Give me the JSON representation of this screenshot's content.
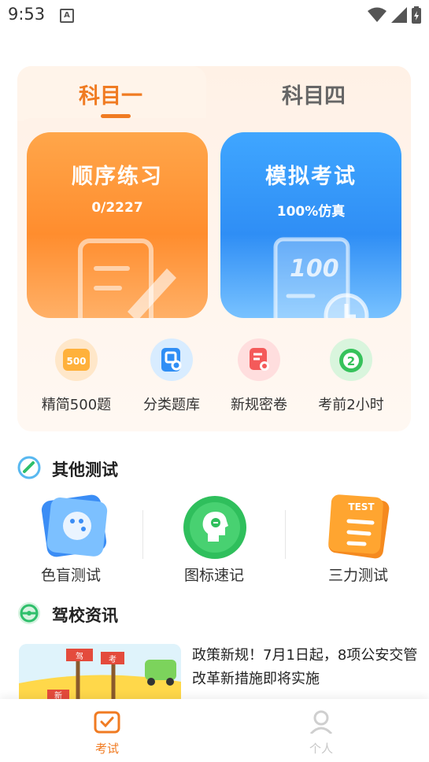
{
  "status_bar": {
    "time": "9:53",
    "notification": "A"
  },
  "subject_tabs": [
    {
      "label": "科目一",
      "active": true
    },
    {
      "label": "科目四",
      "active": false
    }
  ],
  "practice_cards": {
    "sequential": {
      "title": "顺序练习",
      "subtitle": "0/2227"
    },
    "mock_exam": {
      "title": "模拟考试",
      "subtitle": "100%仿真"
    }
  },
  "quick_actions": [
    {
      "label": "精简500题",
      "icon": "500-badge-icon"
    },
    {
      "label": "分类题库",
      "icon": "category-book-icon"
    },
    {
      "label": "新规密卷",
      "icon": "secret-paper-icon"
    },
    {
      "label": "考前2小时",
      "icon": "timer-2-icon"
    }
  ],
  "other_tests": {
    "title": "其他测试",
    "items": [
      {
        "label": "色盲测试",
        "icon": "palette-icon"
      },
      {
        "label": "图标速记",
        "icon": "head-memory-icon"
      },
      {
        "label": "三力测试",
        "icon": "test-list-icon",
        "badge": "TEST"
      }
    ]
  },
  "news": {
    "title": "驾校资讯",
    "items": [
      {
        "headline": "政策新规！7月1日起，8项公安交管改革新措施即将实施",
        "image_tags": [
          "驾",
          "考",
          "新"
        ]
      }
    ]
  },
  "bottom_nav": [
    {
      "label": "考试",
      "active": true
    },
    {
      "label": "个人",
      "active": false
    }
  ],
  "colors": {
    "accent_orange": "#f07b22",
    "accent_blue": "#2f8ef5"
  }
}
